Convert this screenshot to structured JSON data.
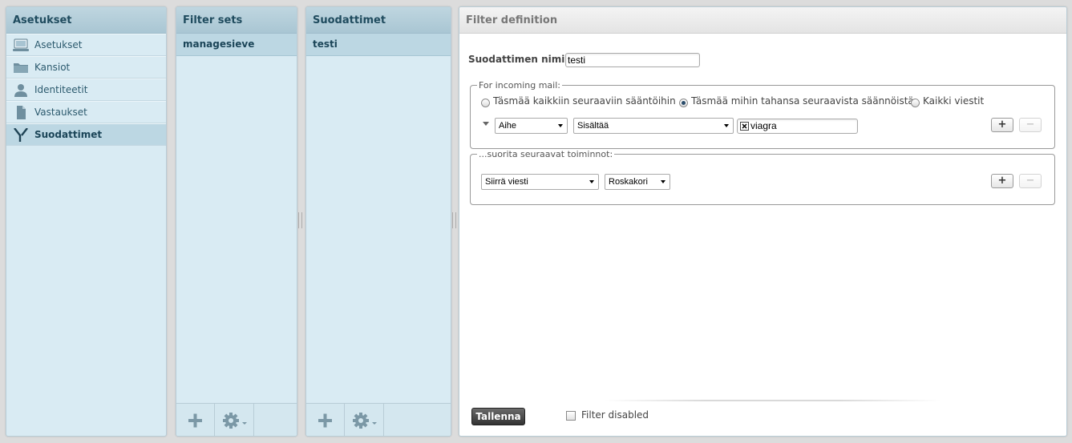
{
  "settings_panel": {
    "title": "Asetukset",
    "items": [
      {
        "label": "Asetukset",
        "icon": "monitor-icon"
      },
      {
        "label": "Kansiot",
        "icon": "folder-icon"
      },
      {
        "label": "Identiteetit",
        "icon": "person-icon"
      },
      {
        "label": "Vastaukset",
        "icon": "document-icon"
      },
      {
        "label": "Suodattimet",
        "icon": "filter-icon",
        "selected": true
      }
    ]
  },
  "filter_sets_panel": {
    "title": "Filter sets",
    "items": [
      "managesieve"
    ],
    "footer": {
      "add": "plus-icon",
      "actions": "gear-icon"
    }
  },
  "filters_panel": {
    "title": "Suodattimet",
    "items": [
      "testi"
    ],
    "footer": {
      "add": "plus-icon",
      "actions": "gear-icon"
    }
  },
  "definition": {
    "title": "Filter definition",
    "name_label": "Suodattimen nimi:",
    "name_value": "testi",
    "incoming": {
      "legend": "For incoming mail:",
      "options": [
        {
          "label": "Täsmää kaikkiin seuraaviin sääntöihin",
          "checked": false
        },
        {
          "label": "Täsmää mihin tahansa seuraavista säännöistä",
          "checked": true
        },
        {
          "label": "Kaikki viestit",
          "checked": false
        }
      ],
      "rule": {
        "header": "Aihe",
        "operator": "Sisältää",
        "value": "viagra"
      },
      "add_label": "+",
      "remove_label": "−"
    },
    "actions": {
      "legend": "...suorita seuraavat toiminnot:",
      "action": "Siirrä viesti",
      "target": "Roskakori",
      "add_label": "+",
      "remove_label": "−"
    },
    "save_label": "Tallenna",
    "disabled_label": "Filter disabled",
    "disabled_checked": false
  },
  "colors": {
    "panel_bg": "#d9ebf3",
    "header_bg": "#a9c6d3",
    "selected_bg": "#bcd7e3",
    "text_dark": "#1b4558"
  }
}
